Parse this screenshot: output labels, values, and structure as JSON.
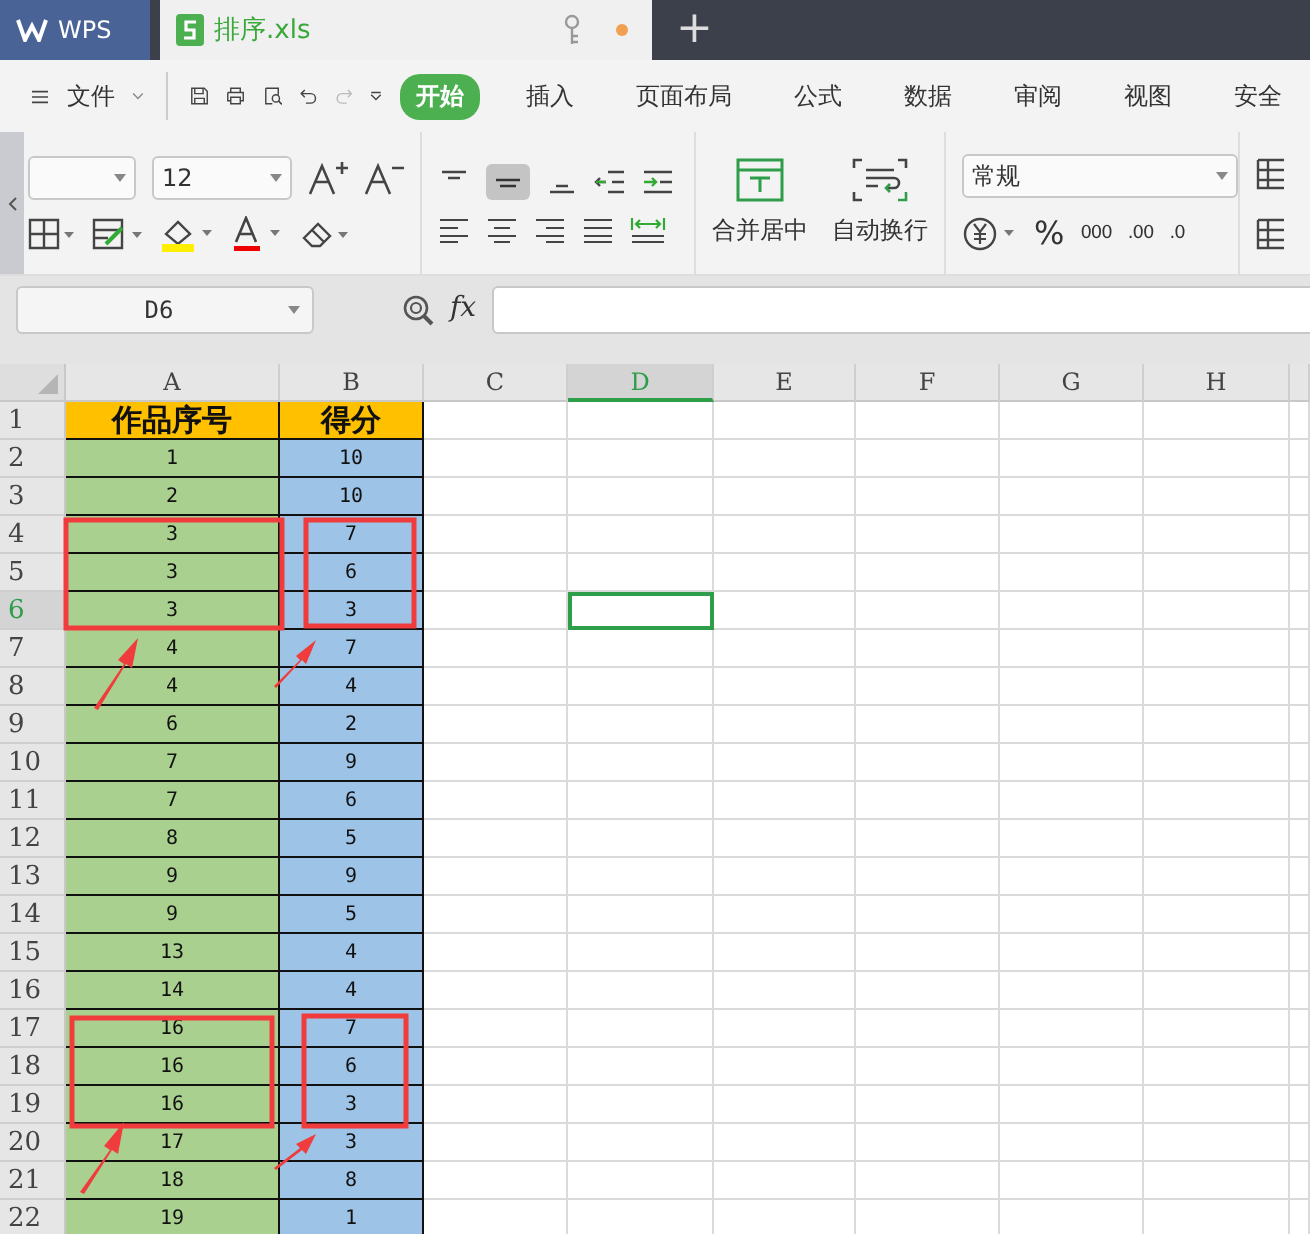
{
  "title_tabs": [
    {
      "label": "WPS",
      "kind": "app",
      "selected": false
    },
    {
      "label": "排序.xls",
      "kind": "file",
      "selected": true,
      "modified": true
    }
  ],
  "new_tab": "+",
  "menu": {
    "file": "文件",
    "tabs": [
      {
        "label": "开始",
        "selected": true
      },
      {
        "label": "插入",
        "selected": false
      },
      {
        "label": "页面布局",
        "selected": false
      },
      {
        "label": "公式",
        "selected": false
      },
      {
        "label": "数据",
        "selected": false
      },
      {
        "label": "审阅",
        "selected": false
      },
      {
        "label": "视图",
        "selected": false
      },
      {
        "label": "安全",
        "selected": false
      }
    ]
  },
  "ribbon": {
    "font_size": "12",
    "merge": "合并居中",
    "wrap": "自动换行",
    "number_format": "常规",
    "percent": "%",
    "thousands": "000",
    "increase_decimal": ".00",
    "decrease_decimal": ".0"
  },
  "formula_bar": {
    "name_box": "D6",
    "fx": "fx"
  },
  "sheet": {
    "columns": [
      {
        "label": "A",
        "selected": false
      },
      {
        "label": "B",
        "selected": false
      },
      {
        "label": "C",
        "selected": false
      },
      {
        "label": "D",
        "selected": true
      },
      {
        "label": "E",
        "selected": false
      },
      {
        "label": "F",
        "selected": false
      },
      {
        "label": "G",
        "selected": false
      },
      {
        "label": "H",
        "selected": false
      }
    ],
    "rows": [
      {
        "number": "1",
        "selected": false,
        "cells": [
          "作品序号",
          "得分"
        ]
      },
      {
        "number": "2",
        "selected": false,
        "cells": [
          "1",
          "10"
        ]
      },
      {
        "number": "3",
        "selected": false,
        "cells": [
          "2",
          "10"
        ]
      },
      {
        "number": "4",
        "selected": false,
        "cells": [
          "3",
          "7"
        ]
      },
      {
        "number": "5",
        "selected": false,
        "cells": [
          "3",
          "6"
        ]
      },
      {
        "number": "6",
        "selected": true,
        "cells": [
          "3",
          "3"
        ]
      },
      {
        "number": "7",
        "selected": false,
        "cells": [
          "4",
          "7"
        ]
      },
      {
        "number": "8",
        "selected": false,
        "cells": [
          "4",
          "4"
        ]
      },
      {
        "number": "9",
        "selected": false,
        "cells": [
          "6",
          "2"
        ]
      },
      {
        "number": "10",
        "selected": false,
        "cells": [
          "7",
          "9"
        ]
      },
      {
        "number": "11",
        "selected": false,
        "cells": [
          "7",
          "6"
        ]
      },
      {
        "number": "12",
        "selected": false,
        "cells": [
          "8",
          "5"
        ]
      },
      {
        "number": "13",
        "selected": false,
        "cells": [
          "9",
          "9"
        ]
      },
      {
        "number": "14",
        "selected": false,
        "cells": [
          "9",
          "5"
        ]
      },
      {
        "number": "15",
        "selected": false,
        "cells": [
          "13",
          "4"
        ]
      },
      {
        "number": "16",
        "selected": false,
        "cells": [
          "14",
          "4"
        ]
      },
      {
        "number": "17",
        "selected": false,
        "cells": [
          "16",
          "7"
        ]
      },
      {
        "number": "18",
        "selected": false,
        "cells": [
          "16",
          "6"
        ]
      },
      {
        "number": "19",
        "selected": false,
        "cells": [
          "16",
          "3"
        ]
      },
      {
        "number": "20",
        "selected": false,
        "cells": [
          "17",
          "3"
        ]
      },
      {
        "number": "21",
        "selected": false,
        "cells": [
          "18",
          "8"
        ]
      },
      {
        "number": "22",
        "selected": false,
        "cells": [
          "19",
          "1"
        ]
      }
    ]
  }
}
